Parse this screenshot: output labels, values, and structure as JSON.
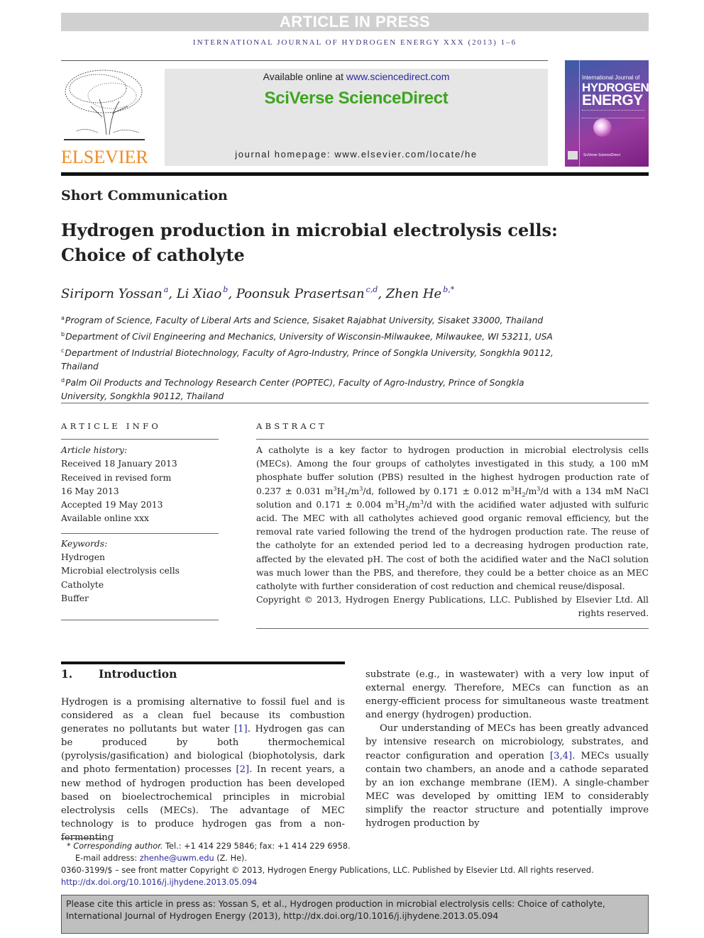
{
  "banner": {
    "text": "ARTICLE IN PRESS"
  },
  "journal_line": "INTERNATIONAL JOURNAL OF HYDROGEN ENERGY XXX (2013) 1–6",
  "publisher": {
    "logo_text": "ELSEVIER",
    "available_prefix": "Available online at ",
    "available_link": "www.sciencedirect.com",
    "brand": "SciVerse ScienceDirect",
    "homepage": "journal homepage: www.elsevier.com/locate/he"
  },
  "cover": {
    "line1": "International Journal of",
    "line2": "HYDROGEN",
    "line3": "ENERGY",
    "footer": "SciVerse ScienceDirect"
  },
  "article": {
    "section_type": "Short Communication",
    "title_line1": "Hydrogen production in microbial electrolysis cells:",
    "title_line2": "Choice of catholyte",
    "authors": [
      {
        "name": "Siriporn Yossan",
        "sup": "a"
      },
      {
        "name": "Li Xiao",
        "sup": "b"
      },
      {
        "name": "Poonsuk Prasertsan",
        "sup": "c,d"
      },
      {
        "name": "Zhen He",
        "sup": "b,*"
      }
    ],
    "affiliations": [
      {
        "key": "a",
        "text": "Program of Science, Faculty of Liberal Arts and Science, Sisaket Rajabhat University, Sisaket 33000, Thailand"
      },
      {
        "key": "b",
        "text": "Department of Civil Engineering and Mechanics, University of Wisconsin-Milwaukee, Milwaukee, WI 53211, USA"
      },
      {
        "key": "c",
        "text": "Department of Industrial Biotechnology, Faculty of Agro-Industry, Prince of Songkla University, Songkhla 90112, Thailand"
      },
      {
        "key": "d",
        "text": "Palm Oil Products and Technology Research Center (POPTEC), Faculty of Agro-Industry, Prince of Songkla University, Songkhla 90112, Thailand"
      }
    ]
  },
  "article_info": {
    "heading": "ARTICLE INFO",
    "history_label": "Article history:",
    "history": [
      "Received 18 January 2013",
      "Received in revised form",
      "16 May 2013",
      "Accepted 19 May 2013",
      "Available online xxx"
    ],
    "keywords_label": "Keywords:",
    "keywords": [
      "Hydrogen",
      "Microbial electrolysis cells",
      "Catholyte",
      "Buffer"
    ]
  },
  "abstract": {
    "heading": "ABSTRACT",
    "p1": "A catholyte is a key factor to hydrogen production in microbial electrolysis cells (MECs). Among the four groups of catholytes investigated in this study, a 100 mM phosphate buffer solution (PBS) resulted in the highest hydrogen production rate of ",
    "v1": "0.237 ± 0.031",
    "p2": " with a 134 mM NaCl solution and ",
    "v_follow": "followed by 0.171 ± 0.012",
    "v2": "0.171 ± 0.004",
    "p3": " with the acidified water adjusted with sulfuric acid. The MEC with all catholytes achieved good organic removal efficiency, but the removal rate varied following the trend of the hydrogen production rate. The reuse of the catholyte for an extended period led to a decreasing hydrogen production rate, affected by the elevated pH. The cost of both the acidified water and the NaCl solution was much lower than the PBS, and therefore, they could be a better choice as an MEC catholyte with further consideration of cost reduction and chemical reuse/disposal.",
    "copyright": "Copyright © 2013, Hydrogen Energy Publications, LLC. Published by Elsevier Ltd. All rights reserved."
  },
  "introduction": {
    "number": "1.",
    "heading": "Introduction",
    "left_a": "Hydrogen is a promising alternative to fossil fuel and is considered as a clean fuel because its combustion generates no pollutants but water ",
    "ref1": "[1]",
    "left_b": ". Hydrogen gas can be produced by both thermochemical (pyrolysis/gasification) and biological (biophotolysis, dark and photo fermentation) processes ",
    "ref2": "[2]",
    "left_c": ". In recent years, a new method of hydrogen production has been developed based on bioelectrochemical principles in microbial electrolysis cells (MECs). The advantage of MEC technology is to produce hydrogen gas from a non-fermenting",
    "right_p1": "substrate (e.g., in wastewater) with a very low input of external energy. Therefore, MECs can function as an energy-efficient process for simultaneous waste treatment and energy (hydrogen) production.",
    "right_p2a": "Our understanding of MECs has been greatly advanced by intensive research on microbiology, substrates, and reactor configuration and operation ",
    "ref34": "[3,4]",
    "right_p2b": ". MECs usually contain two chambers, an anode and a cathode separated by an ion exchange membrane (IEM). A single-chamber MEC was developed by omitting IEM to considerably simplify the reactor structure and potentially improve hydrogen production by"
  },
  "footnotes": {
    "star": "*",
    "corr_label": "Corresponding author.",
    "corr_text": " Tel.: +1 414 229 5846; fax: +1 414 229 6958.",
    "email_label": "E-mail address: ",
    "email": "zhenhe@uwm.edu",
    "email_suffix": " (Z. He).",
    "issn": "0360-3199/$ – see front matter Copyright © 2013, Hydrogen Energy Publications, LLC. Published by Elsevier Ltd. All rights reserved.",
    "doi": "http://dx.doi.org/10.1016/j.ijhydene.2013.05.094"
  },
  "cite_box": {
    "line1": "Please cite this article in press as: Yossan S, et al., Hydrogen production in microbial electrolysis cells: Choice of catholyte,",
    "line2": "International Journal of Hydrogen Energy (2013), http://dx.doi.org/10.1016/j.ijhydene.2013.05.094"
  },
  "colors": {
    "link": "#2a2a9a",
    "elsevier_orange": "#f08a24",
    "sciencedirect_green": "#3ea420",
    "banner_gray": "#d0d0d0"
  }
}
